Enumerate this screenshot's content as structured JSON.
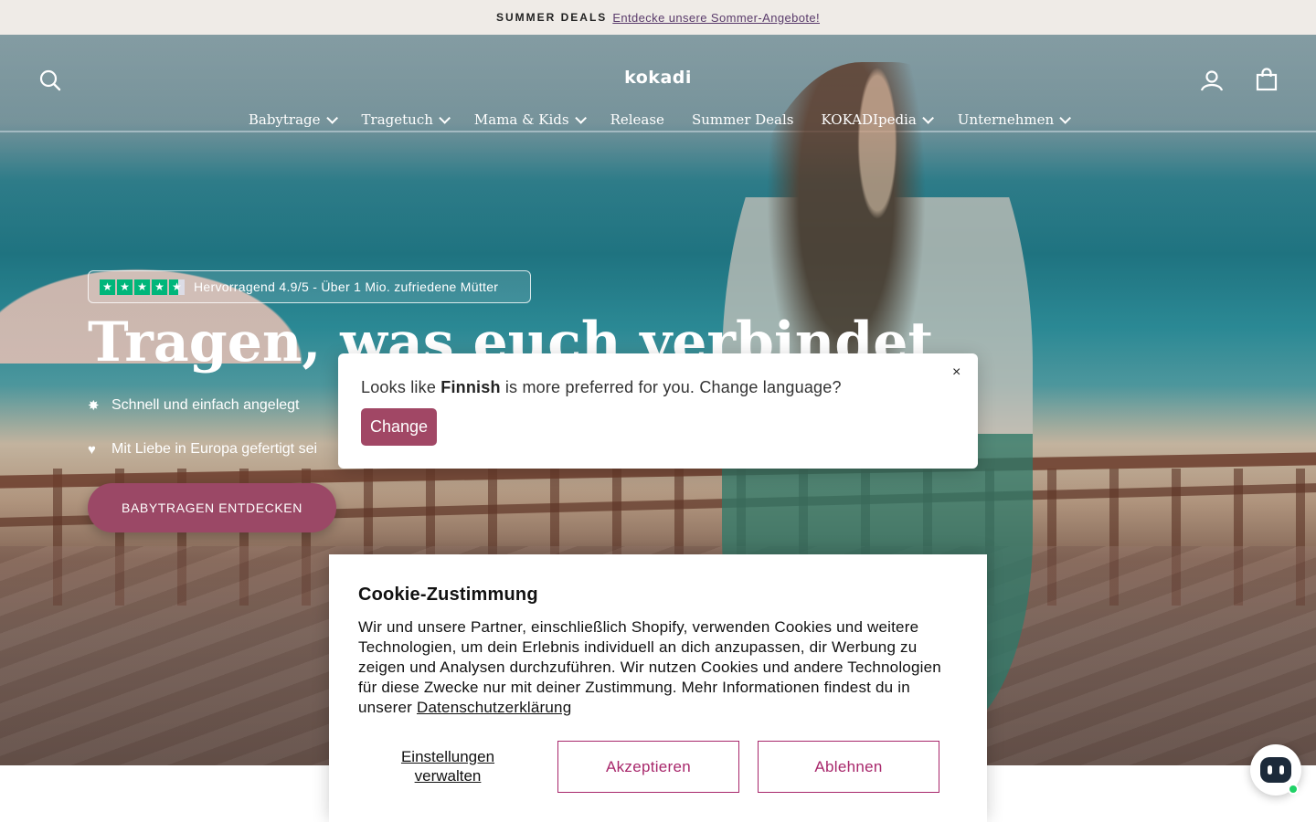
{
  "announcement": {
    "tag": "SUMMER DEALS",
    "link": "Entdecke unsere Sommer-Angebote!"
  },
  "header": {
    "logo": "kokadi",
    "nav": [
      {
        "label": "Babytrage",
        "has_dropdown": true
      },
      {
        "label": "Tragetuch",
        "has_dropdown": true
      },
      {
        "label": "Mama & Kids",
        "has_dropdown": true
      },
      {
        "label": "Release",
        "has_dropdown": false
      },
      {
        "label": "Summer Deals",
        "has_dropdown": false
      },
      {
        "label": "KOKADIpedia",
        "has_dropdown": true
      },
      {
        "label": "Unternehmen",
        "has_dropdown": true
      }
    ],
    "icons": [
      "search-icon",
      "account-icon",
      "cart-icon"
    ]
  },
  "hero": {
    "rating": "Hervorragend 4.9/5 - Über 1 Mio. zufriedene Mütter",
    "rating_stars": 4.5,
    "headline": "Tragen, was euch verbindet",
    "bullets": [
      {
        "icon": "sparkle-icon",
        "text": "Schnell und einfach angelegt"
      },
      {
        "icon": "heart-icon",
        "text": "Mit Liebe in Europa gefertigt sei"
      }
    ],
    "cta": "BABYTRAGEN ENTDECKEN"
  },
  "language_popup": {
    "prefix": "Looks like",
    "language": "Finnish",
    "suffix": "is more preferred for you. Change language?",
    "button": "Change",
    "close": "×"
  },
  "cookie": {
    "title": "Cookie-Zustimmung",
    "body": "Wir und unsere Partner, einschließlich Shopify, verwenden Cookies und weitere Technologien, um dein Erlebnis individuell an dich anzupassen, dir Werbung zu zeigen und Analysen durchzuführen. Wir nutzen Cookies und andere Technologien für diese Zwecke nur mit deiner Zustimmung. Mehr Informationen findest du in unserer",
    "privacy_link": "Datenschutzerklärung",
    "manage": "Einstellungen verwalten",
    "accept": "Akzeptieren",
    "decline": "Ablehnen"
  },
  "colors": {
    "accent": "#9b4866",
    "cookie_button": "#a8276b",
    "announce_bg": "#efebe7",
    "trustpilot": "#00b67a"
  }
}
